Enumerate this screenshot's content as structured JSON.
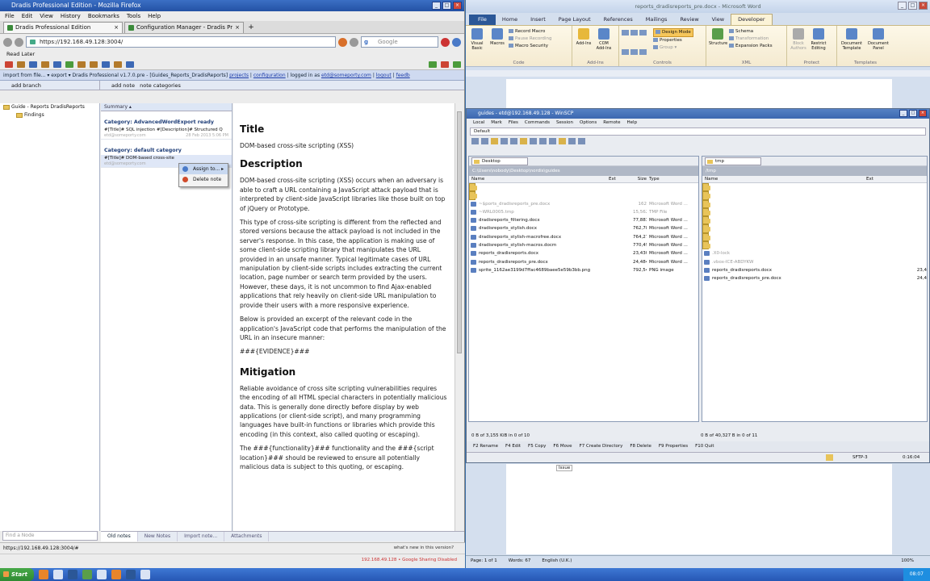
{
  "firefox": {
    "window_title": "Dradis Professional Edition - Mozilla Firefox",
    "menu": [
      "File",
      "Edit",
      "View",
      "History",
      "Bookmarks",
      "Tools",
      "Help"
    ],
    "tabs": [
      "Dradis Professional Edition",
      "Configuration Manager - Dradis Professio..."
    ],
    "url": "https://192.168.49.128:3004/",
    "search_placeholder": "Google",
    "bookmark": "Read Later",
    "status_url": "https://192.168.49.128:3004/#",
    "status_ip": "192.168.49.128",
    "status_sharing": "Google Sharing Disabled"
  },
  "dradis": {
    "toolbar_text": "import from file...  ▾ export ▾  Dradis Professional v1.7.0.pre - [Guides_Reports_DradisReports]",
    "toolbar_links": [
      "projects",
      "configuration"
    ],
    "logged_in": "| logged in as",
    "user": "etd@someporty.com",
    "logout": "logout",
    "feedback": "feedb",
    "add_branch": "add branch",
    "add_note": "add note",
    "note_categories": "note categories",
    "tree": [
      {
        "label": "Guide - Reports DradisReports"
      },
      {
        "label": "Findings"
      }
    ],
    "summary_header": "Summary ▴",
    "categories": [
      {
        "name": "Category: AdvancedWordExport ready",
        "note": "#[Title]# SQL injection #[Description]# Structured Q",
        "author": "etd@someporty.com",
        "date": "28 Feb 2013 5:06 PM"
      },
      {
        "name": "Category: default category",
        "note": "#[Title]# DOM-based cross-site",
        "author": "etd@someporty.com",
        "date": ""
      }
    ],
    "context_menu": [
      "Assign to...",
      "Delete note"
    ],
    "find_node_placeholder": "Find a Node",
    "bottom_tabs": [
      "Old notes",
      "New Notes",
      "Import note...",
      "Attachments"
    ],
    "whats_new": "what's new in this version?"
  },
  "document": {
    "title_heading": "Title",
    "title_text": "DOM-based cross-site scripting (XSS)",
    "desc_heading": "Description",
    "desc_p1": "DOM-based cross-site scripting (XSS) occurs when an adversary is able to craft a URL containing a JavaScript attack payload that is interpreted by client-side JavaScript libraries like those built on top of jQuery or Prototype.",
    "desc_p2": "This type of cross-site scripting is different from the reflected and stored versions because the attack payload is not included in the server's response. In this case, the application is making use of some client-side scripting library that manipulates the URL provided in an unsafe manner. Typical legitimate cases of URL manipulation by client-side scripts includes extracting the current location, page number or search term provided by the users. However, these days, it is not uncommon to find Ajax-enabled applications that rely heavily on client-side URL manipulation to provide their users with a more responsive experience.",
    "desc_p3": "Below is provided an excerpt of the relevant code in the application's JavaScript code that performs the manipulation of the URL in an insecure manner:",
    "evidence": "###{EVIDENCE}###",
    "mit_heading": "Mitigation",
    "mit_p1": "Reliable avoidance of cross site scripting vulnerabilities requires the encoding of all HTML special characters in potentially malicious data. This is generally done directly before display by web applications (or client-side script), and many programming languages have built-in functions or libraries which provide this encoding (in this context, also called quoting or escaping).",
    "mit_p2": "The ###{functionality}### functionality and the ###{script location}### should be reviewed to ensure all potentially malicious data is subject to this quoting, or escaping."
  },
  "word": {
    "window_title": "reports_dradisreports_pre.docx - Microsoft Word",
    "tabs": [
      "File",
      "Home",
      "Insert",
      "Page Layout",
      "References",
      "Mailings",
      "Review",
      "View",
      "Developer"
    ],
    "ribbon_code": {
      "big": [
        "Visual Basic",
        "Macros"
      ],
      "small": [
        "Record Macro",
        "Pause Recording",
        "Macro Security"
      ],
      "name": "Code"
    },
    "ribbon_addins": {
      "big": [
        "Add-Ins",
        "COM Add-Ins"
      ],
      "name": "Add-Ins"
    },
    "ribbon_controls": {
      "small": [
        "Design Mode",
        "Properties",
        "Group ▾"
      ],
      "name": "Controls"
    },
    "ribbon_xml": {
      "big": [
        "Structure"
      ],
      "small": [
        "Schema",
        "Transformation",
        "Expansion Packs"
      ],
      "name": "XML"
    },
    "ribbon_protect": {
      "big": [
        "Block Authors",
        "Restrict Editing"
      ],
      "name": "Protect"
    },
    "ribbon_templates": {
      "big": [
        "Document Template",
        "Document Panel"
      ],
      "name": "Templates"
    },
    "issue_tag": "Issue",
    "status": {
      "page": "Page: 1 of 1",
      "words": "Words: 67",
      "lang": "English (U.K.)",
      "zoom": "100%"
    }
  },
  "winscp": {
    "window_title": "guides - etd@192.168.49.128 - WinSCP",
    "menu": [
      "Local",
      "Mark",
      "Files",
      "Commands",
      "Session",
      "Options",
      "Remote",
      "Help"
    ],
    "session": "Default",
    "left_drive": "Desktop",
    "right_drive": "tmp",
    "left_path": "C:\\Users\\nobody\\Desktop\\nordis\\guides",
    "right_path": "/tmp",
    "left_cols": [
      "Name",
      "Ext",
      "Size",
      "Type"
    ],
    "right_cols": [
      "Name",
      "Ext"
    ],
    "left_files": [
      {
        "name": "..",
        "size": "",
        "type": "Parent directory",
        "kind": "folder"
      },
      {
        "name": "stylish_dradis-export",
        "size": "",
        "type": "File folder",
        "kind": "folder"
      },
      {
        "name": "~$ports_dradisreports_pre.docx",
        "size": "162",
        "type": "Microsoft Word ...",
        "kind": "dim"
      },
      {
        "name": "~WRL0005.tmp",
        "size": "15,562",
        "type": "TMP File",
        "kind": "dim"
      },
      {
        "name": "dradisreports_filtering.docx",
        "size": "77,883",
        "type": "Microsoft Word ...",
        "kind": "file"
      },
      {
        "name": "dradisreports_stylish.docx",
        "size": "762,783",
        "type": "Microsoft Word ...",
        "kind": "file"
      },
      {
        "name": "dradisreports_stylish-macrofree.docx",
        "size": "764,278",
        "type": "Microsoft Word ...",
        "kind": "file"
      },
      {
        "name": "dradisreports_stylish-macros.docm",
        "size": "770,493",
        "type": "Microsoft Word ...",
        "kind": "file"
      },
      {
        "name": "reports_dradisreports.docx",
        "size": "23,430",
        "type": "Microsoft Word ...",
        "kind": "file"
      },
      {
        "name": "reports_dradisreports_pre.docx",
        "size": "24,484",
        "type": "Microsoft Word ...",
        "kind": "file"
      },
      {
        "name": "sprite_1162ae3199d7ffac4689baee5e59b3bb.png",
        "size": "792,542",
        "type": "PNG image",
        "kind": "file"
      }
    ],
    "right_files": [
      {
        "name": "..",
        "size": "",
        "kind": "folder"
      },
      {
        "name": ".ICE-unix",
        "size": "",
        "kind": "folder"
      },
      {
        "name": ".X11-unix",
        "size": "",
        "kind": "folder"
      },
      {
        "name": "acroread_1000_1000",
        "size": "",
        "kind": "folder"
      },
      {
        "name": "hsperfdata_etd",
        "size": "",
        "kind": "folder"
      },
      {
        "name": "orbit-etd",
        "size": "",
        "kind": "folder"
      },
      {
        "name": "ssh-PYluaE1647",
        "size": "",
        "kind": "folder"
      },
      {
        "name": "ssh-QYTQkH2139",
        "size": "",
        "kind": "folder"
      },
      {
        "name": ".X0-lock",
        "size": "",
        "kind": "dim"
      },
      {
        "name": ".vbox-ICE-ABDYKW",
        "size": "",
        "kind": "dim"
      },
      {
        "name": "reports_dradisreports.docx",
        "size": "23,4",
        "kind": "file"
      },
      {
        "name": "reports_dradisreports_pre.docx",
        "size": "24,4",
        "kind": "file"
      }
    ],
    "left_footer": "0 B of 3,155 KiB in 0 of 10",
    "right_footer": "0 B of 40,327 B in 0 of 11",
    "fkeys": [
      "F2 Rename",
      "F4 Edit",
      "F5 Copy",
      "F6 Move",
      "F7 Create Directory",
      "F8 Delete",
      "F9 Properties",
      "F10 Quit"
    ],
    "protocol": "SFTP-3",
    "elapsed": "0:16:04"
  },
  "taskbar": {
    "start": "Start",
    "clock": "08:07"
  }
}
